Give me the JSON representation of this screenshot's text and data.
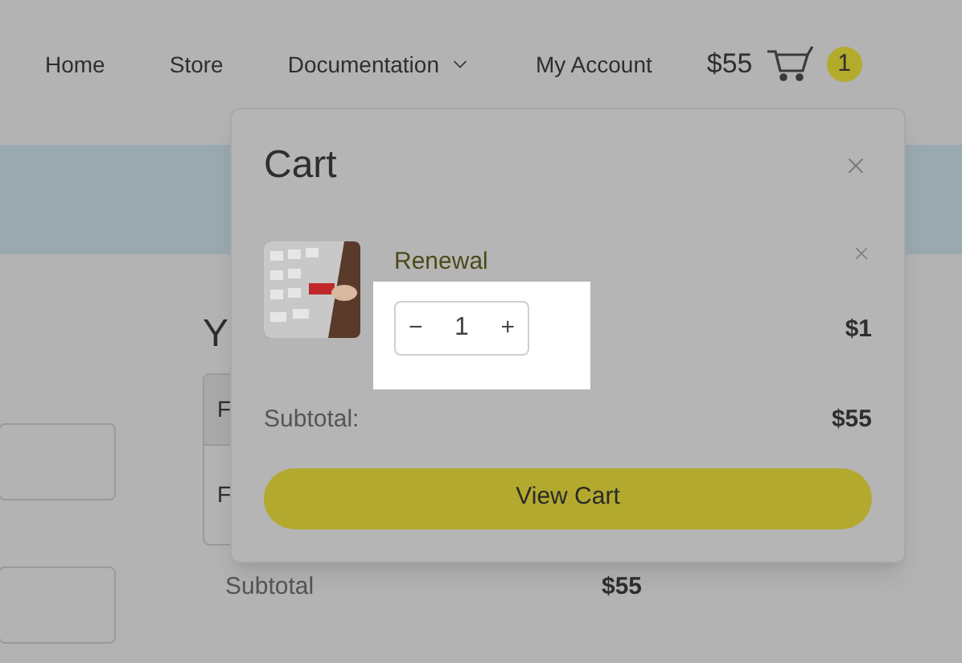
{
  "nav": {
    "items": [
      {
        "label": "Home",
        "has_dropdown": false
      },
      {
        "label": "Store",
        "has_dropdown": false
      },
      {
        "label": "Documentation",
        "has_dropdown": true
      },
      {
        "label": "My Account",
        "has_dropdown": false
      }
    ],
    "cart_total": "$55",
    "cart_count": "1"
  },
  "page": {
    "heading": "Y",
    "table_cells": [
      "F",
      "F"
    ],
    "subtotal_label": "Subtotal",
    "subtotal_value": "$55"
  },
  "cart_popover": {
    "title": "Cart",
    "items": [
      {
        "name": "Renewal",
        "quantity": "1",
        "price": "$1",
        "decrement": "−",
        "increment": "+"
      }
    ],
    "subtotal_label": "Subtotal:",
    "subtotal_value": "$55",
    "button": "View Cart"
  }
}
